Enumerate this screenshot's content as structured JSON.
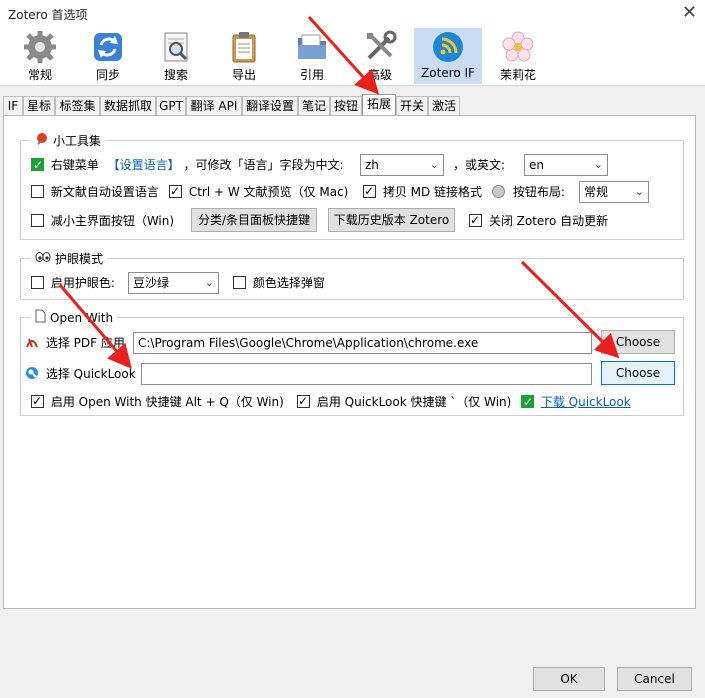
{
  "window": {
    "title": "Zotero 首选项",
    "close_glyph": "✕"
  },
  "toolbar": {
    "items": [
      {
        "label": "常规",
        "icon": "gear-icon"
      },
      {
        "label": "同步",
        "icon": "sync-icon"
      },
      {
        "label": "搜索",
        "icon": "search-doc-icon"
      },
      {
        "label": "导出",
        "icon": "clipboard-icon"
      },
      {
        "label": "引用",
        "icon": "folder-icon"
      },
      {
        "label": "高级",
        "icon": "tools-icon"
      },
      {
        "label": "Zotero IF",
        "icon": "zotero-if-icon",
        "selected": true
      },
      {
        "label": "茉莉花",
        "icon": "jasmine-flower-icon"
      }
    ]
  },
  "tabs": [
    "IF",
    "星标",
    "标签集",
    "数据抓取",
    "GPT",
    "翻译 API",
    "翻译设置",
    "笔记",
    "按钮",
    "拓展",
    "开关",
    "激活"
  ],
  "active_tab": "拓展",
  "tools_group": {
    "title": "小工具集",
    "right_click_menu": {
      "label": "右键菜单",
      "checked": true
    },
    "set_language_link": "【设置语言】",
    "modify_text": "，可修改「语言」字段为中文:",
    "zh_value": "zh",
    "or_english_text": "，或英文:",
    "en_value": "en",
    "new_item_lang": {
      "label": "新文献自动设置语言",
      "checked": false
    },
    "ctrl_w_preview": {
      "label": "Ctrl + W 文献预览（仅 Mac)",
      "checked": true
    },
    "copy_md": {
      "label": "拷贝 MD 链接格式",
      "checked": true
    },
    "button_layout_label": "按钮布局:",
    "button_layout_value": "常规",
    "reduce_buttons": {
      "label": "减小主界面按钮（Win)",
      "checked": false
    },
    "category_shortcut_button": "分类/条目面板快捷键",
    "download_history_button": "下载历史版本 Zotero",
    "disable_auto_update": {
      "label": "关闭 Zotero 自动更新",
      "checked": true
    }
  },
  "eye_group": {
    "title": "护眼模式",
    "enable_eye": {
      "label": "启用护眼色:",
      "checked": false
    },
    "eye_color_value": "豆沙绿",
    "color_popup": {
      "label": "颜色选择弹窗",
      "checked": false
    }
  },
  "open_with_group": {
    "title": "Open With",
    "pdf_label": "选择 PDF 应用",
    "pdf_path": "C:\\Program Files\\Google\\Chrome\\Application\\chrome.exe",
    "choose_label": "Choose",
    "quicklook_label": "选择 QuickLook",
    "quicklook_path": "",
    "open_with_shortcut": {
      "label": "启用 Open With 快捷键 Alt + Q（仅 Win)",
      "checked": true
    },
    "quicklook_shortcut": {
      "label": "启用 QuickLook 快捷键 `（仅 Win)",
      "checked": true
    },
    "download_quicklook": {
      "label": "下载 QuickLook",
      "checked": true
    }
  },
  "footer": {
    "ok_label": "OK",
    "cancel_label": "Cancel"
  },
  "colors": {
    "accent": "#0078d7",
    "arrow_red": "#e8211f",
    "checkbox_green": "#19a33a",
    "link_blue": "#0b5fbd"
  }
}
